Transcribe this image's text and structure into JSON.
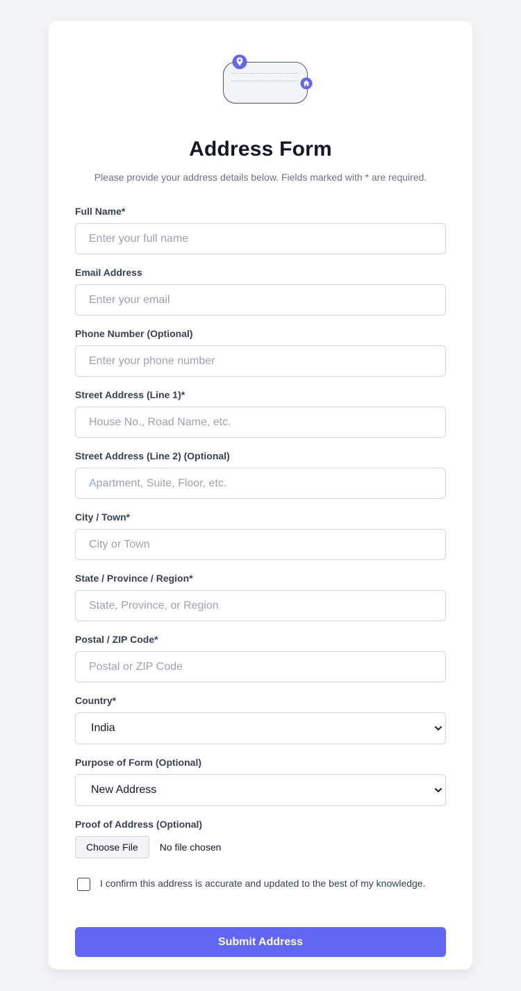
{
  "header": {
    "title": "Address Form",
    "subtitle": "Please provide your address details below. Fields marked with * are required."
  },
  "illustration": {
    "pin_icon": "map-pin-icon",
    "home_icon": "home-icon",
    "accent_color": "#6366f1"
  },
  "fields": {
    "full_name": {
      "label": "Full Name*",
      "placeholder": "Enter your full name",
      "value": ""
    },
    "email": {
      "label": "Email Address",
      "placeholder": "Enter your email",
      "value": ""
    },
    "phone": {
      "label": "Phone Number (Optional)",
      "placeholder": "Enter your phone number",
      "value": ""
    },
    "street1": {
      "label": "Street Address (Line 1)*",
      "placeholder": "House No., Road Name, etc.",
      "value": ""
    },
    "street2": {
      "label": "Street Address (Line 2) (Optional)",
      "placeholder": "Apartment, Suite, Floor, etc.",
      "value": ""
    },
    "city": {
      "label": "City / Town*",
      "placeholder": "City or Town",
      "value": ""
    },
    "state": {
      "label": "State / Province / Region*",
      "placeholder": "State, Province, or Region",
      "value": ""
    },
    "postal": {
      "label": "Postal / ZIP Code*",
      "placeholder": "Postal or ZIP Code",
      "value": ""
    },
    "country": {
      "label": "Country*",
      "selected": "India"
    },
    "purpose": {
      "label": "Purpose of Form (Optional)",
      "selected": "New Address"
    },
    "proof": {
      "label": "Proof of Address (Optional)",
      "button_label": "Choose File",
      "status": "No file chosen"
    }
  },
  "confirm": {
    "checked": false,
    "text": "I confirm this address is accurate and updated to the best of my knowledge."
  },
  "submit": {
    "label": "Submit Address",
    "color": "#6366f1"
  }
}
